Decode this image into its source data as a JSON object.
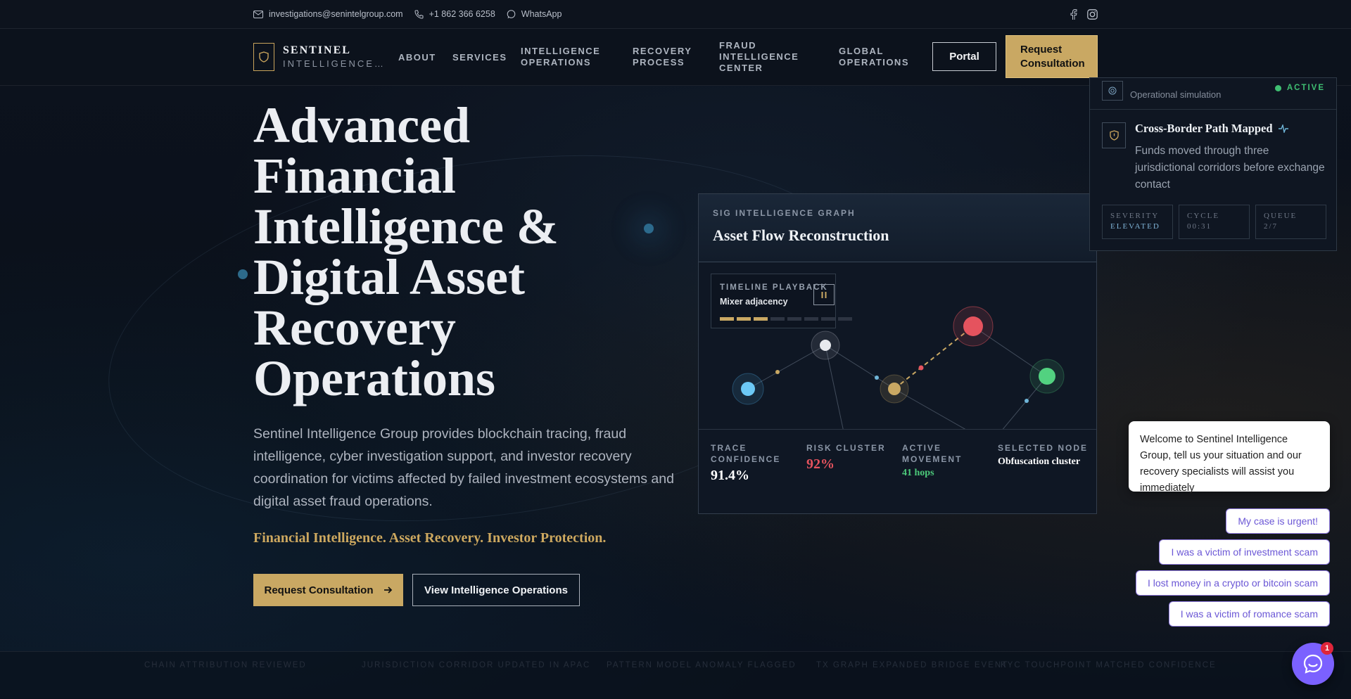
{
  "topbar": {
    "email": "investigations@senintelgroup.com",
    "phone": "+1 862 366 6258",
    "whatsapp": "WhatsApp",
    "icons": [
      "mail-icon",
      "phone-icon",
      "whatsapp-icon",
      "facebook-icon",
      "instagram-icon"
    ]
  },
  "nav": {
    "brand_name": "SENTINEL",
    "brand_sub": "INTELLIGENCE…",
    "links": [
      "ABOUT",
      "SERVICES",
      "INTELLIGENCE OPERATIONS",
      "RECOVERY PROCESS",
      "FRAUD INTELLIGENCE CENTER",
      "GLOBAL OPERATIONS"
    ],
    "portal_label": "Portal",
    "request_label": "Request Consultation"
  },
  "hero": {
    "title": "Advanced Financial Intelligence & Digital Asset Recovery Operations",
    "description": "Sentinel Intelligence Group provides blockchain tracing, fraud intelligence, cyber investigation support, and investor recovery coordination for victims affected by failed investment ecosystems and digital asset fraud operations.",
    "tagline": "Financial Intelligence. Asset Recovery. Investor Protection.",
    "primary_cta": "Request Consultation",
    "secondary_cta": "View Intelligence Operations"
  },
  "graph_card": {
    "kicker": "SIG INTELLIGENCE GRAPH",
    "title": "Asset Flow Reconstruction",
    "playback": {
      "kicker": "TIMELINE PLAYBACK",
      "label": "Mixer adjacency",
      "progress_steps_total": 8,
      "progress_steps_done": 3
    },
    "stats": [
      {
        "label": "TRACE CONFIDENCE",
        "value": "91.4%",
        "color": "#ffffff"
      },
      {
        "label": "RISK CLUSTER",
        "value": "92%",
        "color": "#e5535e"
      },
      {
        "label": "ACTIVE MOVEMENT",
        "value": "41 hops",
        "color": "#4cc97a"
      },
      {
        "label": "SELECTED NODE",
        "value": "Obfuscation cluster",
        "color": "#ffffff"
      }
    ]
  },
  "alert_card": {
    "sim_label": "Operational simulation",
    "status": "ACTIVE",
    "title": "Cross-Border Path Mapped",
    "description": "Funds moved through three jurisdictional corridors before exchange contact",
    "chips": [
      {
        "label": "SEVERITY",
        "value": "ELEVATED",
        "color": "#7fb3d6"
      },
      {
        "label": "CYCLE",
        "value": "00:31",
        "color": "#6e7786"
      },
      {
        "label": "QUEUE",
        "value": "2/7",
        "color": "#6e7786"
      }
    ]
  },
  "chat": {
    "greeting": "Welcome to Sentinel Intelligence Group, tell us your situation and our recovery specialists will assist you immediately",
    "options": [
      "My case is urgent!",
      "I was a victim of investment scam",
      "I lost money in a crypto or bitcoin scam",
      "I was a victim of romance scam"
    ],
    "badge": "1"
  },
  "ticker": {
    "items": [
      "CHAIN ATTRIBUTION REVIEWED",
      "JURISDICTION CORRIDOR UPDATED IN APAC",
      "PATTERN MODEL ANOMALY FLAGGED",
      "TX GRAPH EXPANDED BRIDGE EVENT",
      "KYC TOUCHPOINT MATCHED CONFIDENCE"
    ]
  },
  "colors": {
    "accent_gold": "#c9a863",
    "background": "#0b111c",
    "risk_red": "#e5535e",
    "active_green": "#3fbf72",
    "chat_purple": "#7b61ff"
  }
}
